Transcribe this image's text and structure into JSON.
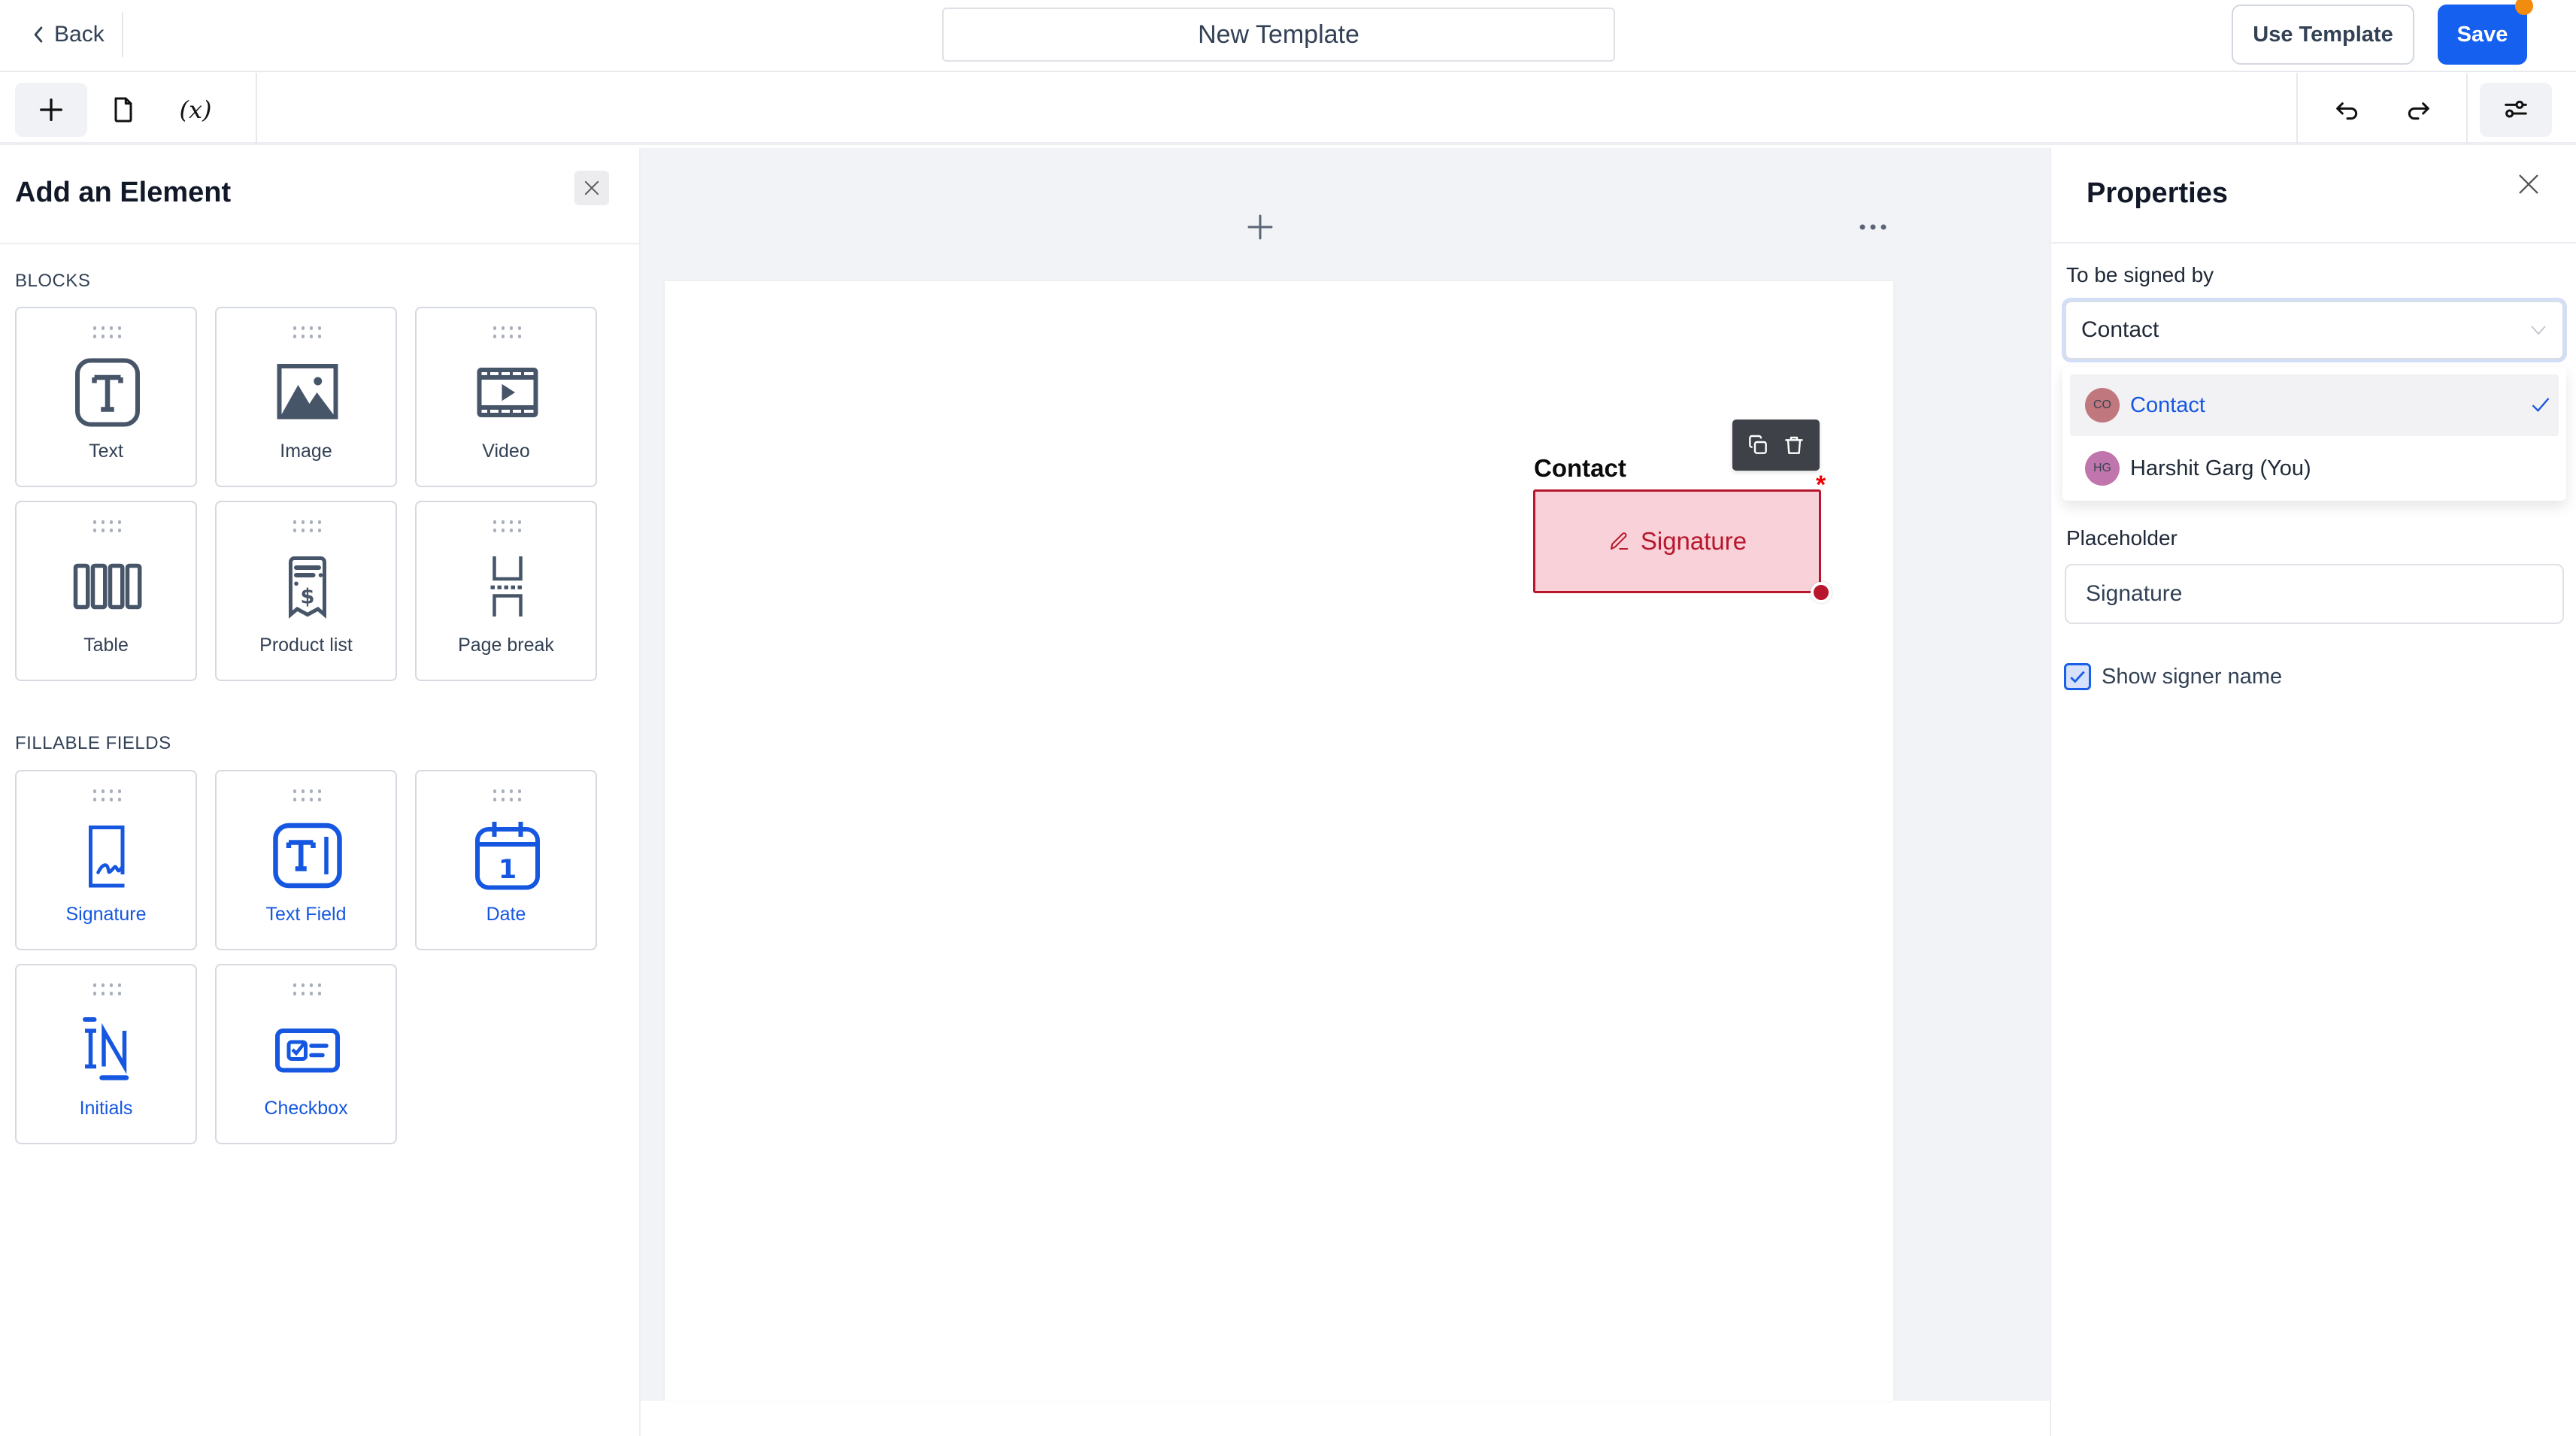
{
  "header": {
    "back_label": "Back",
    "title_value": "New Template",
    "use_template_label": "Use Template",
    "save_label": "Save",
    "save_has_unsaved_indicator": true
  },
  "toolbar": {
    "left_buttons": [
      {
        "icon": "plus-icon",
        "active": true
      },
      {
        "icon": "document-icon",
        "active": false
      },
      {
        "icon": "variable-icon",
        "glyph": "(x)",
        "active": false
      }
    ],
    "right_buttons": [
      {
        "icon": "undo-icon"
      },
      {
        "icon": "redo-icon"
      },
      {
        "icon": "settings-sliders-icon",
        "active": true
      }
    ]
  },
  "left_panel": {
    "title": "Add an Element",
    "sections": [
      {
        "label": "BLOCKS",
        "items": [
          {
            "label": "Text",
            "icon": "text-block-icon"
          },
          {
            "label": "Image",
            "icon": "image-icon"
          },
          {
            "label": "Video",
            "icon": "video-icon"
          },
          {
            "label": "Table",
            "icon": "table-icon"
          },
          {
            "label": "Product list",
            "icon": "receipt-icon"
          },
          {
            "label": "Page break",
            "icon": "page-break-icon"
          }
        ]
      },
      {
        "label": "FILLABLE FIELDS",
        "items": [
          {
            "label": "Signature",
            "icon": "signature-icon"
          },
          {
            "label": "Text Field",
            "icon": "text-field-icon"
          },
          {
            "label": "Date",
            "icon": "calendar-icon"
          },
          {
            "label": "Initials",
            "icon": "initials-icon"
          },
          {
            "label": "Checkbox",
            "icon": "checkbox-field-icon"
          }
        ]
      }
    ]
  },
  "canvas": {
    "signature_field": {
      "signer_label": "Contact",
      "placeholder": "Signature",
      "required_marker": "*",
      "colors": {
        "fill": "#f8d2d8",
        "border": "#b8162d"
      }
    }
  },
  "properties": {
    "title": "Properties",
    "signed_by": {
      "label": "To be signed by",
      "value": "Contact",
      "options": [
        {
          "initials": "CO",
          "name": "Contact",
          "selected": true,
          "avatar_color": "#c0777e"
        },
        {
          "initials": "HG",
          "name": "Harshit Garg (You)",
          "selected": false,
          "avatar_color": "#c076ad"
        }
      ]
    },
    "placeholder": {
      "label": "Placeholder",
      "value": "Signature"
    },
    "show_signer_name": {
      "label": "Show signer name",
      "checked": true
    }
  },
  "colors": {
    "primary": "#1560ef",
    "unsaved_dot": "#f28c0f",
    "canvas_bg": "#f2f3f7"
  }
}
